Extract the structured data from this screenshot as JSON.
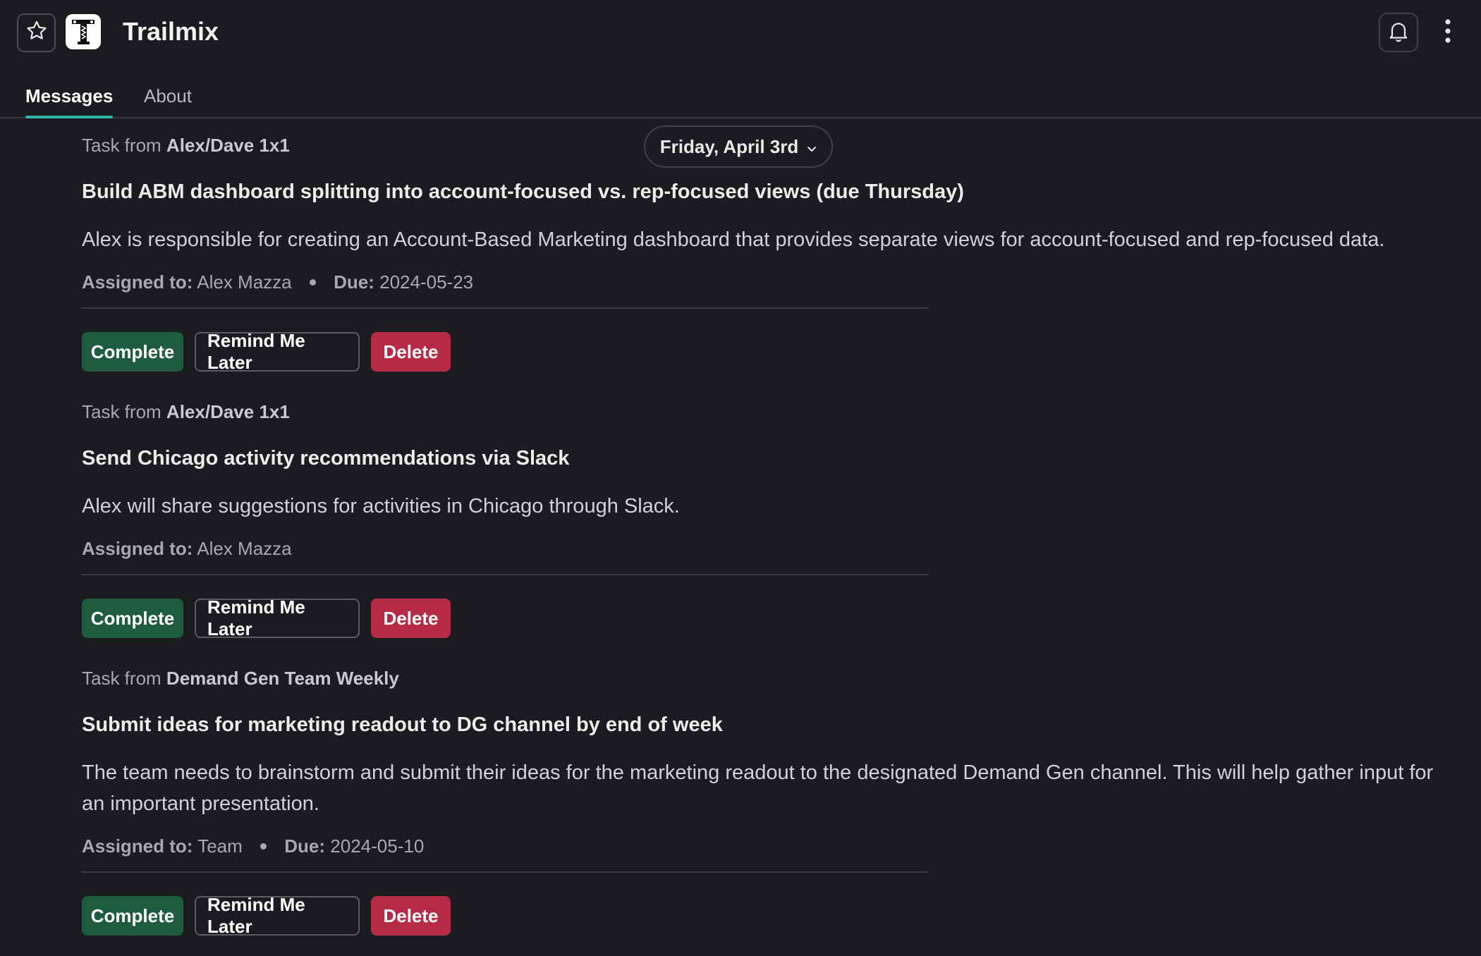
{
  "app": {
    "title": "Trailmix",
    "logo_icon": "trailmix-logo-icon",
    "colors": {
      "background": "#1b1c20",
      "tab_underline": "#2fb5a7",
      "complete": "#1f5c3f",
      "delete": "#b52b45"
    }
  },
  "header": {
    "star_icon": "star-icon",
    "bell_icon": "bell-icon",
    "more_icon": "vertical-dots-icon"
  },
  "tabs": [
    {
      "label": "Messages",
      "active": true
    },
    {
      "label": "About",
      "active": false
    }
  ],
  "date_divider": {
    "label": "Friday, April 3rd",
    "icon": "chevron-down-icon"
  },
  "tasks": [
    {
      "source_prefix": "Task from",
      "source": "Alex/Dave 1x1",
      "title": "Build ABM dashboard splitting into account-focused vs. rep-focused views (due Thursday)",
      "description": "Alex is responsible for creating an Account-Based Marketing dashboard that provides separate views for account-focused and rep-focused data.",
      "assigned_label": "Assigned to:",
      "assigned_to": "Alex Mazza",
      "due_label": "Due:",
      "due": "2024-05-23",
      "actions": {
        "complete": "Complete",
        "remind": "Remind Me Later",
        "delete": "Delete"
      }
    },
    {
      "source_prefix": "Task from",
      "source": "Alex/Dave 1x1",
      "title": "Send Chicago activity recommendations via Slack",
      "description": "Alex will share suggestions for activities in Chicago through Slack.",
      "assigned_label": "Assigned to:",
      "assigned_to": "Alex Mazza",
      "actions": {
        "complete": "Complete",
        "remind": "Remind Me Later",
        "delete": "Delete"
      }
    },
    {
      "source_prefix": "Task from",
      "source": "Demand Gen Team Weekly",
      "title": "Submit ideas for marketing readout to DG channel by end of week",
      "description": "The team needs to brainstorm and submit their ideas for the marketing readout to the designated Demand Gen channel. This will help gather input for an important presentation.",
      "assigned_label": "Assigned to:",
      "assigned_to": "Team",
      "due_label": "Due:",
      "due": "2024-05-10",
      "actions": {
        "complete": "Complete",
        "remind": "Remind Me Later",
        "delete": "Delete"
      }
    }
  ]
}
